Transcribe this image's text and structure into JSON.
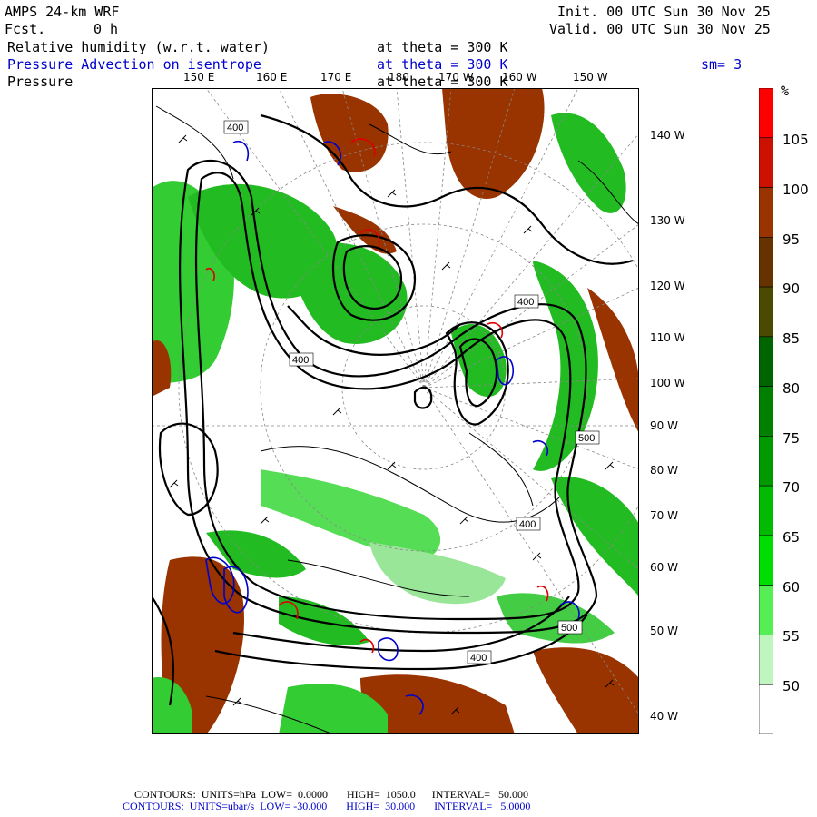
{
  "header": {
    "model": "AMPS 24-km WRF",
    "fcst_label": "Fcst.",
    "fcst_value": "0 h",
    "init": "Init. 00 UTC Sun 30 Nov 25",
    "valid": "Valid. 00 UTC Sun 30 Nov 25"
  },
  "fields": [
    {
      "name": "Relative humidity (w.r.t. water)",
      "level": "at theta = 300 K",
      "extra": "",
      "color": "#000000"
    },
    {
      "name": "Pressure Advection on isentrope",
      "level": "at theta = 300 K",
      "extra": "sm= 3",
      "color": "#0000cc"
    },
    {
      "name": "Pressure",
      "level": "at theta = 300 K",
      "extra": "",
      "color": "#000000"
    }
  ],
  "longitude_labels": {
    "top": [
      "150 E",
      "160 E",
      "170 E",
      "180",
      "170 W",
      "160 W",
      "150 W"
    ],
    "right": [
      "140 W",
      "130 W",
      "120 W",
      "110 W",
      "100 W",
      "90 W",
      "80 W",
      "70 W",
      "60 W",
      "50 W",
      "40 W"
    ]
  },
  "contour_labels": [
    "400",
    "400",
    "400",
    "500",
    "400",
    "500",
    "400"
  ],
  "colorbar": {
    "unit": "%",
    "ticks": [
      "105",
      "100",
      "95",
      "90",
      "85",
      "80",
      "75",
      "70",
      "65",
      "60",
      "55",
      "50"
    ],
    "colors": [
      "#ff0000",
      "#cc1100",
      "#993300",
      "#663300",
      "#4a4a00",
      "#006400",
      "#007f00",
      "#009900",
      "#00bb00",
      "#00dd00",
      "#55ee55",
      "#bff5bf",
      "#ffffff"
    ]
  },
  "footer": {
    "line1": "CONTOURS:  UNITS=hPa  LOW=  0.0000       HIGH=  1050.0      INTERVAL=   50.000",
    "line2": "CONTOURS:  UNITS=ubar/s  LOW= -30.000       HIGH=  30.000       INTERVAL=   5.0000"
  }
}
